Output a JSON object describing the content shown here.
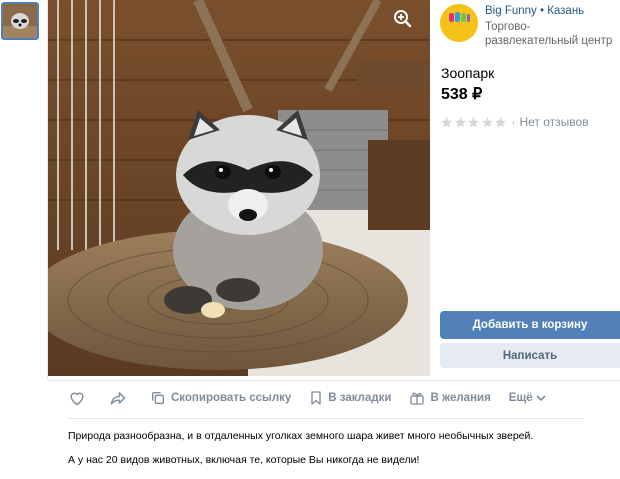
{
  "seller": {
    "name": "Big Funny • Казань",
    "type": "Торгово-развлекательный центр",
    "logo_text": "Big Funny"
  },
  "product": {
    "title": "Зоопарк",
    "price": "538 ₽",
    "rating_text": "Нет отзывов",
    "stars": 0,
    "stars_total": 5
  },
  "buttons": {
    "add_to_cart": "Добавить в корзину",
    "message": "Написать"
  },
  "actions": {
    "copy_link": "Скопировать ссылку",
    "bookmarks": "В закладки",
    "wishlist": "В желания",
    "more": "Ещё"
  },
  "description": {
    "p1": "Природа разнообразна, и в отдаленных уголках земного шара живет много необычных зверей.",
    "p2": "А у нас 20 видов животных, включая те, которые Вы никогда не видели!"
  },
  "colors": {
    "accent": "#5181b8",
    "link": "#2a5885",
    "muted": "#818c99"
  }
}
